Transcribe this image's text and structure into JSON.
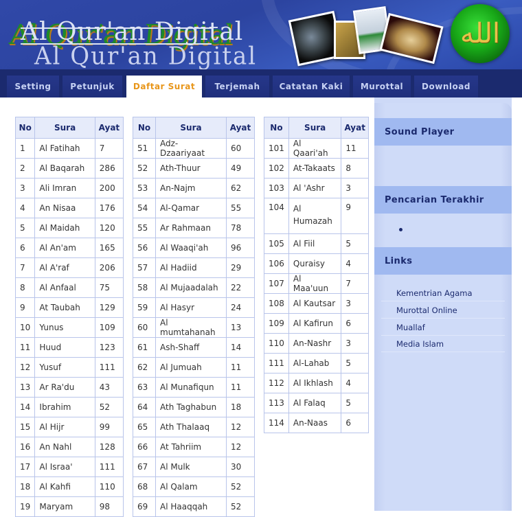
{
  "header": {
    "logo_text": "Al Qur'an Digital",
    "logo_reflection": "Al Qur'an Digital",
    "medallion_glyph": "الله",
    "colors": {
      "header_bg": "#2f47a6",
      "nav_bg": "#1b2a6e",
      "active_tab_text": "#e8961a"
    }
  },
  "nav": {
    "tabs": [
      {
        "label": "Setting"
      },
      {
        "label": "Petunjuk"
      },
      {
        "label": "Daftar Surat",
        "active": true
      },
      {
        "label": "Terjemah"
      },
      {
        "label": "Catatan Kaki"
      },
      {
        "label": "Murottal"
      },
      {
        "label": "Download"
      }
    ]
  },
  "table_headers": {
    "no": "No",
    "sura": "Sura",
    "ayat": "Ayat"
  },
  "tables": [
    {
      "rows": [
        [
          "1",
          "Al Fatihah",
          "7"
        ],
        [
          "2",
          "Al Baqarah",
          "286"
        ],
        [
          "3",
          "Ali Imran",
          "200"
        ],
        [
          "4",
          "An Nisaa",
          "176"
        ],
        [
          "5",
          "Al Maidah",
          "120"
        ],
        [
          "6",
          "Al An'am",
          "165"
        ],
        [
          "7",
          "Al A'raf",
          "206"
        ],
        [
          "8",
          "Al Anfaal",
          "75"
        ],
        [
          "9",
          "At Taubah",
          "129"
        ],
        [
          "10",
          "Yunus",
          "109"
        ],
        [
          "11",
          "Huud",
          "123"
        ],
        [
          "12",
          "Yusuf",
          "111"
        ],
        [
          "13",
          "Ar Ra'du",
          "43"
        ],
        [
          "14",
          "Ibrahim",
          "52"
        ],
        [
          "15",
          "Al Hijr",
          "99"
        ],
        [
          "16",
          "An Nahl",
          "128"
        ],
        [
          "17",
          "Al Israa'",
          "111"
        ],
        [
          "18",
          "Al Kahfi",
          "110"
        ],
        [
          "19",
          "Maryam",
          "98"
        ]
      ]
    },
    {
      "rows": [
        [
          "51",
          "Adz-Dzaariyaat",
          "60"
        ],
        [
          "52",
          "Ath-Thuur",
          "49"
        ],
        [
          "53",
          "An-Najm",
          "62"
        ],
        [
          "54",
          "Al-Qamar",
          "55"
        ],
        [
          "55",
          "Ar Rahmaan",
          "78"
        ],
        [
          "56",
          "Al Waaqi'ah",
          "96"
        ],
        [
          "57",
          "Al Hadiid",
          "29"
        ],
        [
          "58",
          "Al Mujaadalah",
          "22"
        ],
        [
          "59",
          "Al Hasyr",
          "24"
        ],
        [
          "60",
          "Al mumtahanah",
          "13"
        ],
        [
          "61",
          "Ash-Shaff",
          "14"
        ],
        [
          "62",
          "Al Jumuah",
          "11"
        ],
        [
          "63",
          "Al Munafiqun",
          "11"
        ],
        [
          "64",
          "Ath Taghabun",
          "18"
        ],
        [
          "65",
          "Ath Thalaaq",
          "12"
        ],
        [
          "66",
          "At Tahriim",
          "12"
        ],
        [
          "67",
          "Al Mulk",
          "30"
        ],
        [
          "68",
          "Al Qalam",
          "52"
        ],
        [
          "69",
          "Al Haaqqah",
          "52"
        ]
      ]
    },
    {
      "rows": [
        [
          "101",
          "Al Qaari'ah",
          "11"
        ],
        [
          "102",
          "At-Takaats",
          "8"
        ],
        [
          "103",
          "Al 'Ashr",
          "3"
        ],
        [
          "104",
          "Al Humazah",
          "9"
        ],
        [
          "105",
          "Al Fiil",
          "5"
        ],
        [
          "106",
          "Quraisy",
          "4"
        ],
        [
          "107",
          "Al Maa'uun",
          "7"
        ],
        [
          "108",
          "Al Kautsar",
          "3"
        ],
        [
          "109",
          "Al Kafirun",
          "6"
        ],
        [
          "110",
          "An-Nashr",
          "3"
        ],
        [
          "111",
          "Al-Lahab",
          "5"
        ],
        [
          "112",
          "Al Ikhlash",
          "4"
        ],
        [
          "113",
          "Al Falaq",
          "5"
        ],
        [
          "114",
          "An-Naas",
          "6"
        ]
      ]
    }
  ],
  "sidebar": {
    "sound_player": {
      "title": "Sound Player"
    },
    "recent_search": {
      "title": "Pencarian Terakhir",
      "items": [
        ""
      ]
    },
    "links": {
      "title": "Links",
      "items": [
        {
          "label": "Kementrian Agama"
        },
        {
          "label": "Murottal Online"
        },
        {
          "label": "Muallaf"
        },
        {
          "label": "Media Islam"
        }
      ]
    }
  }
}
